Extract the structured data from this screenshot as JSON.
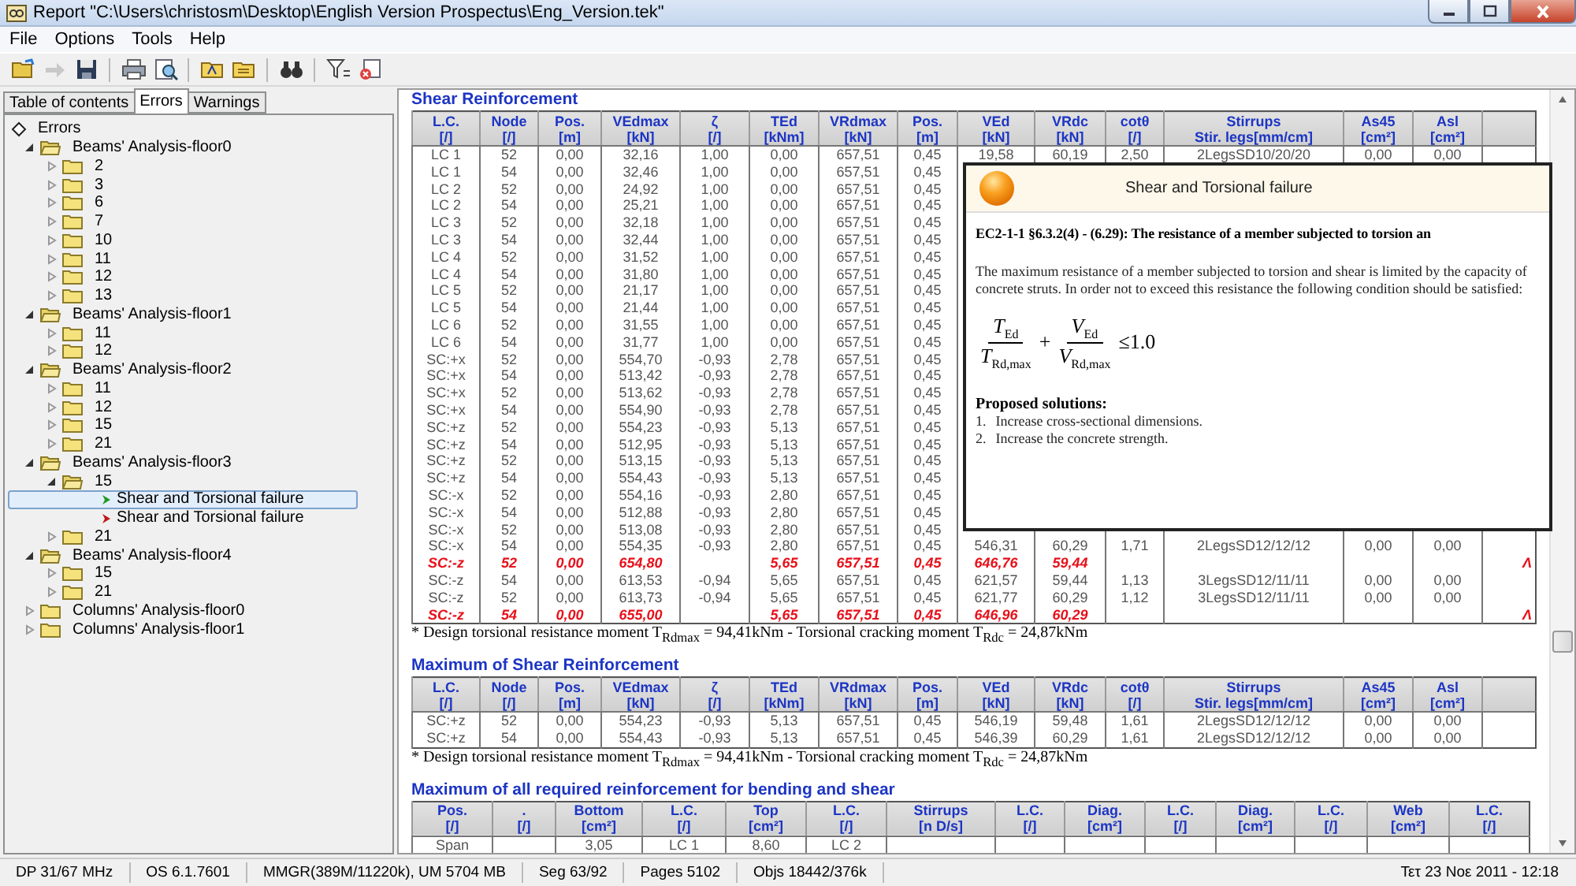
{
  "window": {
    "title": "Report \"C:\\Users\\christosm\\Desktop\\English Version Prospectus\\Eng_Version.tek\""
  },
  "menu": [
    "File",
    "Options",
    "Tools",
    "Help"
  ],
  "tabs": [
    {
      "label": "Table of contents",
      "selected": false
    },
    {
      "label": "Errors",
      "selected": true
    },
    {
      "label": "Warnings",
      "selected": false
    }
  ],
  "tree": {
    "label": "Errors",
    "kind": "root",
    "selected": false,
    "children": [
      {
        "label": "Beams' Analysis-floor0",
        "kind": "folder",
        "expanded": true,
        "selected": false,
        "children": [
          {
            "label": "2",
            "kind": "folder",
            "expanded": false,
            "selected": false
          },
          {
            "label": "3",
            "kind": "folder",
            "expanded": false,
            "selected": false
          },
          {
            "label": "6",
            "kind": "folder",
            "expanded": false,
            "selected": false
          },
          {
            "label": "7",
            "kind": "folder",
            "expanded": false,
            "selected": false
          },
          {
            "label": "10",
            "kind": "folder",
            "expanded": false,
            "selected": false
          },
          {
            "label": "11",
            "kind": "folder",
            "expanded": false,
            "selected": false
          },
          {
            "label": "12",
            "kind": "folder",
            "expanded": false,
            "selected": false
          },
          {
            "label": "13",
            "kind": "folder",
            "expanded": false,
            "selected": false
          }
        ]
      },
      {
        "label": "Beams' Analysis-floor1",
        "kind": "folder",
        "expanded": true,
        "selected": false,
        "children": [
          {
            "label": "11",
            "kind": "folder",
            "expanded": false,
            "selected": false
          },
          {
            "label": "12",
            "kind": "folder",
            "expanded": false,
            "selected": false
          }
        ]
      },
      {
        "label": "Beams' Analysis-floor2",
        "kind": "folder",
        "expanded": true,
        "selected": false,
        "children": [
          {
            "label": "11",
            "kind": "folder",
            "expanded": false,
            "selected": false
          },
          {
            "label": "12",
            "kind": "folder",
            "expanded": false,
            "selected": false
          },
          {
            "label": "15",
            "kind": "folder",
            "expanded": false,
            "selected": false
          },
          {
            "label": "21",
            "kind": "folder",
            "expanded": false,
            "selected": false
          }
        ]
      },
      {
        "label": "Beams' Analysis-floor3",
        "kind": "folder",
        "expanded": true,
        "selected": false,
        "children": [
          {
            "label": "15",
            "kind": "folder",
            "expanded": true,
            "selected": false,
            "children": [
              {
                "label": "Shear and Torsional failure",
                "kind": "error",
                "color": "#1f9a1f",
                "selected": true
              },
              {
                "label": "Shear and Torsional failure",
                "kind": "error",
                "color": "#c01818",
                "selected": false
              }
            ]
          },
          {
            "label": "21",
            "kind": "folder",
            "expanded": false,
            "selected": false
          }
        ]
      },
      {
        "label": "Beams' Analysis-floor4",
        "kind": "folder",
        "expanded": true,
        "selected": false,
        "children": [
          {
            "label": "15",
            "kind": "folder",
            "expanded": false,
            "selected": false
          },
          {
            "label": "21",
            "kind": "folder",
            "expanded": false,
            "selected": false
          }
        ]
      },
      {
        "label": "Columns' Analysis-floor0",
        "kind": "folder",
        "expanded": false,
        "selected": false
      },
      {
        "label": "Columns' Analysis-floor1",
        "kind": "folder",
        "expanded": false,
        "selected": false
      }
    ]
  },
  "report": {
    "sections": [
      {
        "title": "Shear Reinforcement",
        "kind": "shear",
        "columns": [
          {
            "name": "L.C.",
            "unit": "[/]"
          },
          {
            "name": "Node",
            "unit": "[/]"
          },
          {
            "name": "Pos.",
            "unit": "[m]"
          },
          {
            "name": "VEdmax",
            "unit": "[kN]"
          },
          {
            "name": "ζ",
            "unit": "[/]"
          },
          {
            "name": "TEd",
            "unit": "[kNm]"
          },
          {
            "name": "VRdmax",
            "unit": "[kN]"
          },
          {
            "name": "Pos.",
            "unit": "[m]"
          },
          {
            "name": "VEd",
            "unit": "[kN]"
          },
          {
            "name": "VRdc",
            "unit": "[kN]"
          },
          {
            "name": "cotθ",
            "unit": "[/]"
          },
          {
            "name": "Stirrups",
            "unit": "Stir. legs[mm/cm]"
          },
          {
            "name": "As45",
            "unit": "[cm²]"
          },
          {
            "name": "Asl",
            "unit": "[cm²]"
          }
        ],
        "rows": [
          {
            "failed": false,
            "cells": [
              "LC 1",
              "52",
              "0,00",
              "32,16",
              "1,00",
              "0,00",
              "657,51",
              "0,45",
              "19,58",
              "60,19",
              "2,50",
              "2LegsSD10/20/20",
              "0,00",
              "0,00"
            ]
          },
          {
            "failed": false,
            "cells": [
              "LC 1",
              "54",
              "0,00",
              "32,46",
              "1,00",
              "0,00",
              "657,51",
              "0,45"
            ]
          },
          {
            "failed": false,
            "cells": [
              "LC 2",
              "52",
              "0,00",
              "24,92",
              "1,00",
              "0,00",
              "657,51",
              "0,45"
            ]
          },
          {
            "failed": false,
            "cells": [
              "LC 2",
              "54",
              "0,00",
              "25,21",
              "1,00",
              "0,00",
              "657,51",
              "0,45"
            ]
          },
          {
            "failed": false,
            "cells": [
              "LC 3",
              "52",
              "0,00",
              "32,18",
              "1,00",
              "0,00",
              "657,51",
              "0,45"
            ]
          },
          {
            "failed": false,
            "cells": [
              "LC 3",
              "54",
              "0,00",
              "32,44",
              "1,00",
              "0,00",
              "657,51",
              "0,45"
            ]
          },
          {
            "failed": false,
            "cells": [
              "LC 4",
              "52",
              "0,00",
              "31,52",
              "1,00",
              "0,00",
              "657,51",
              "0,45"
            ]
          },
          {
            "failed": false,
            "cells": [
              "LC 4",
              "54",
              "0,00",
              "31,80",
              "1,00",
              "0,00",
              "657,51",
              "0,45"
            ]
          },
          {
            "failed": false,
            "cells": [
              "LC 5",
              "52",
              "0,00",
              "21,17",
              "1,00",
              "0,00",
              "657,51",
              "0,45"
            ]
          },
          {
            "failed": false,
            "cells": [
              "LC 5",
              "54",
              "0,00",
              "21,44",
              "1,00",
              "0,00",
              "657,51",
              "0,45"
            ]
          },
          {
            "failed": false,
            "cells": [
              "LC 6",
              "52",
              "0,00",
              "31,55",
              "1,00",
              "0,00",
              "657,51",
              "0,45"
            ]
          },
          {
            "failed": false,
            "cells": [
              "LC 6",
              "54",
              "0,00",
              "31,77",
              "1,00",
              "0,00",
              "657,51",
              "0,45"
            ]
          },
          {
            "failed": false,
            "cells": [
              "SC:+x",
              "52",
              "0,00",
              "554,70",
              "-0,93",
              "2,78",
              "657,51",
              "0,45"
            ]
          },
          {
            "failed": false,
            "cells": [
              "SC:+x",
              "54",
              "0,00",
              "513,42",
              "-0,93",
              "2,78",
              "657,51",
              "0,45"
            ]
          },
          {
            "failed": false,
            "cells": [
              "SC:+x",
              "52",
              "0,00",
              "513,62",
              "-0,93",
              "2,78",
              "657,51",
              "0,45"
            ]
          },
          {
            "failed": false,
            "cells": [
              "SC:+x",
              "54",
              "0,00",
              "554,90",
              "-0,93",
              "2,78",
              "657,51",
              "0,45"
            ]
          },
          {
            "failed": false,
            "cells": [
              "SC:+z",
              "52",
              "0,00",
              "554,23",
              "-0,93",
              "5,13",
              "657,51",
              "0,45"
            ]
          },
          {
            "failed": false,
            "cells": [
              "SC:+z",
              "54",
              "0,00",
              "512,95",
              "-0,93",
              "5,13",
              "657,51",
              "0,45"
            ]
          },
          {
            "failed": false,
            "cells": [
              "SC:+z",
              "52",
              "0,00",
              "513,15",
              "-0,93",
              "5,13",
              "657,51",
              "0,45"
            ]
          },
          {
            "failed": false,
            "cells": [
              "SC:+z",
              "54",
              "0,00",
              "554,43",
              "-0,93",
              "5,13",
              "657,51",
              "0,45"
            ]
          },
          {
            "failed": false,
            "cells": [
              "SC:-x",
              "52",
              "0,00",
              "554,16",
              "-0,93",
              "2,80",
              "657,51",
              "0,45"
            ]
          },
          {
            "failed": false,
            "cells": [
              "SC:-x",
              "54",
              "0,00",
              "512,88",
              "-0,93",
              "2,80",
              "657,51",
              "0,45"
            ]
          },
          {
            "failed": false,
            "cells": [
              "SC:-x",
              "52",
              "0,00",
              "513,08",
              "-0,93",
              "2,80",
              "657,51",
              "0,45"
            ]
          },
          {
            "failed": false,
            "cells": [
              "SC:-x",
              "54",
              "0,00",
              "554,35",
              "-0,93",
              "2,80",
              "657,51",
              "0,45",
              "546,31",
              "60,29",
              "1,71",
              "2LegsSD12/12/12",
              "0,00",
              "0,00"
            ]
          },
          {
            "failed": true,
            "cells": [
              "SC:-z",
              "52",
              "0,00",
              "654,80",
              null,
              "5,65",
              "657,51",
              "0,45",
              "646,76",
              "59,44",
              null,
              null,
              null,
              null,
              "Λ"
            ]
          },
          {
            "failed": false,
            "cells": [
              "SC:-z",
              "54",
              "0,00",
              "613,53",
              "-0,94",
              "5,65",
              "657,51",
              "0,45",
              "621,57",
              "59,44",
              "1,13",
              "3LegsSD12/11/11",
              "0,00",
              "0,00"
            ]
          },
          {
            "failed": false,
            "cells": [
              "SC:-z",
              "52",
              "0,00",
              "613,73",
              "-0,94",
              "5,65",
              "657,51",
              "0,45",
              "621,77",
              "60,29",
              "1,12",
              "3LegsSD12/11/11",
              "0,00",
              "0,00"
            ]
          },
          {
            "failed": true,
            "cells": [
              "SC:-z",
              "54",
              "0,00",
              "655,00",
              null,
              "5,65",
              "657,51",
              "0,45",
              "646,96",
              "60,29",
              null,
              null,
              null,
              null,
              "Λ"
            ]
          }
        ],
        "note": "* Design torsional resistance moment T$_{Rdmax}$ = 94,41kNm - Torsional cracking moment T$_{Rdc}$ = 24,87kNm"
      },
      {
        "title": "Maximum of Shear Reinforcement",
        "kind": "shear",
        "columns": [
          {
            "name": "L.C.",
            "unit": "[/]"
          },
          {
            "name": "Node",
            "unit": "[/]"
          },
          {
            "name": "Pos.",
            "unit": "[m]"
          },
          {
            "name": "VEdmax",
            "unit": "[kN]"
          },
          {
            "name": "ζ",
            "unit": "[/]"
          },
          {
            "name": "TEd",
            "unit": "[kNm]"
          },
          {
            "name": "VRdmax",
            "unit": "[kN]"
          },
          {
            "name": "Pos.",
            "unit": "[m]"
          },
          {
            "name": "VEd",
            "unit": "[kN]"
          },
          {
            "name": "VRdc",
            "unit": "[kN]"
          },
          {
            "name": "cotθ",
            "unit": "[/]"
          },
          {
            "name": "Stirrups",
            "unit": "Stir. legs[mm/cm]"
          },
          {
            "name": "As45",
            "unit": "[cm²]"
          },
          {
            "name": "Asl",
            "unit": "[cm²]"
          }
        ],
        "rows": [
          {
            "failed": false,
            "cells": [
              "SC:+z",
              "52",
              "0,00",
              "554,23",
              "-0,93",
              "5,13",
              "657,51",
              "0,45",
              "546,19",
              "59,48",
              "1,61",
              "2LegsSD12/12/12",
              "0,00",
              "0,00"
            ]
          },
          {
            "failed": false,
            "cells": [
              "SC:+z",
              "54",
              "0,00",
              "554,43",
              "-0,93",
              "5,13",
              "657,51",
              "0,45",
              "546,39",
              "60,29",
              "1,61",
              "2LegsSD12/12/12",
              "0,00",
              "0,00"
            ]
          }
        ],
        "note": "* Design torsional resistance moment T$_{Rdmax}$ = 94,41kNm - Torsional cracking moment T$_{Rdc}$ = 24,87kNm"
      },
      {
        "title": "Maximum of all required reinforcement for bending and shear",
        "kind": "bending",
        "columns": [
          {
            "name": "Pos.",
            "unit": "[/]"
          },
          {
            "name": ".",
            "unit": "[/]"
          },
          {
            "name": "Bottom",
            "unit": "[cm²]"
          },
          {
            "name": "L.C.",
            "unit": "[/]"
          },
          {
            "name": "Top",
            "unit": "[cm²]"
          },
          {
            "name": "L.C.",
            "unit": "[/]"
          },
          {
            "name": "Stirrups",
            "unit": "[n D/s]"
          },
          {
            "name": "L.C.",
            "unit": "[/]"
          },
          {
            "name": "Diag.",
            "unit": "[cm²]"
          },
          {
            "name": "L.C.",
            "unit": "[/]"
          },
          {
            "name": "Diag.",
            "unit": "[cm²]"
          },
          {
            "name": "L.C.",
            "unit": "[/]"
          },
          {
            "name": "Web",
            "unit": "[cm²]"
          },
          {
            "name": "L.C.",
            "unit": "[/]"
          }
        ],
        "rows": [
          {
            "failed": false,
            "cells": [
              "Span",
              null,
              "3,05",
              "LC 1",
              "8,60",
              "LC 2"
            ]
          }
        ]
      }
    ]
  },
  "popup": {
    "title": "Shear and Torsional failure",
    "heading": "EC2-1-1 §6.3.2(4) - (6.29): The resistance of a member subjected to torsion an",
    "text": "The maximum resistance of a member subjected to torsion and shear is limited by the capacity of concrete struts. In order not to exceed this resistance the following condition should be satisfied:",
    "formula": {
      "terms": [
        {
          "numerator": "T$_{Ed}$",
          "denominator": "T$_{Rd,max}$"
        },
        {
          "numerator": "V$_{Ed}$",
          "denominator": "V$_{Rd,max}$"
        }
      ],
      "operator": "+",
      "relation": "≤1.0"
    },
    "solutions_title": "Proposed solutions:",
    "solutions": [
      {
        "number": "1.",
        "text": "Increase cross-sectional dimensions."
      },
      {
        "number": "2.",
        "text": "Increase the concrete strength."
      }
    ]
  },
  "status_bar": [
    "DP 31/67 MHz",
    "OS 6.1.7601",
    "MMGR(389M/11220k), UM 5704 MB",
    "Seg 63/92",
    "Pages 5102",
    "Objs 18442/376k",
    "Τετ 23 Νοε 2011 - 12:18"
  ]
}
